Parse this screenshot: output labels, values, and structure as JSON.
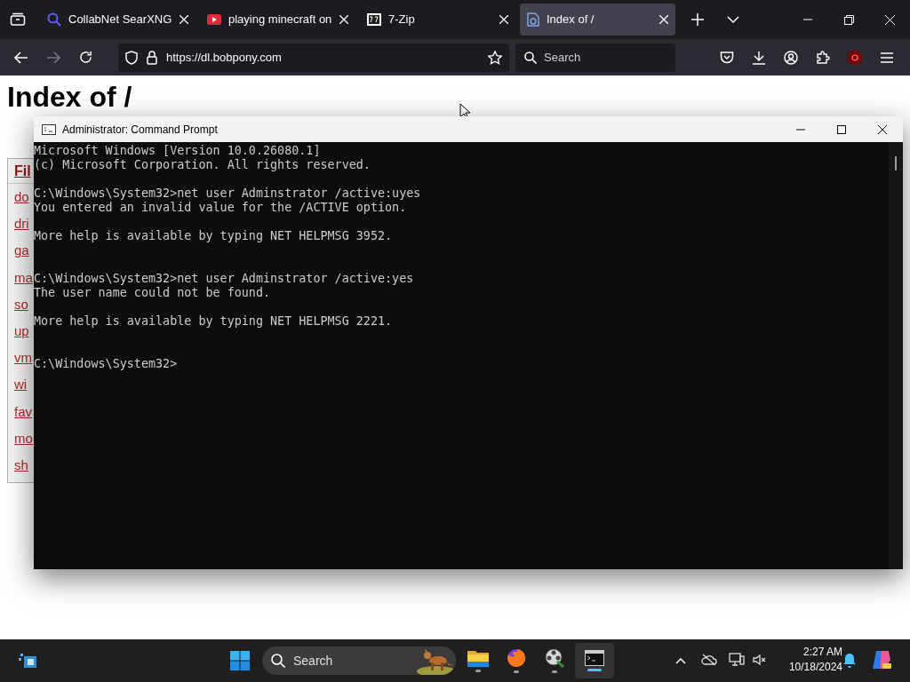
{
  "browser": {
    "tabs": [
      {
        "title": "CollabNet SearXNG",
        "selected": false
      },
      {
        "title": "playing minecraft on",
        "selected": false
      },
      {
        "title": "7-Zip",
        "selected": false
      },
      {
        "title": "Index of /",
        "selected": true
      }
    ],
    "url": "https://dl.bobpony.com",
    "search": {
      "placeholder": "Search"
    }
  },
  "page": {
    "heading": "Index of /",
    "table_header": "Fil",
    "links": [
      "do",
      "dri",
      "ga",
      "ma",
      "so",
      "up",
      "vm",
      "wi",
      "fav",
      "mo",
      "sh"
    ]
  },
  "console_window": {
    "title": "Administrator: Command Prompt",
    "lines": [
      {
        "kind": "text",
        "text": "Microsoft Windows [Version 10.0.26080.1]"
      },
      {
        "kind": "text",
        "text": "(c) Microsoft Corporation. All rights reserved."
      },
      {
        "kind": "blank"
      },
      {
        "kind": "text",
        "text": "C:\\Windows\\System32>net user Adminstrator /active:uyes"
      },
      {
        "kind": "text",
        "text": "You entered an invalid value for the /ACTIVE option."
      },
      {
        "kind": "blank"
      },
      {
        "kind": "text",
        "text": "More help is available by typing NET HELPMSG 3952."
      },
      {
        "kind": "blank"
      },
      {
        "kind": "blank"
      },
      {
        "kind": "text",
        "text": "C:\\Windows\\System32>net user Adminstrator /active:yes"
      },
      {
        "kind": "text",
        "text": "The user name could not be found."
      },
      {
        "kind": "blank"
      },
      {
        "kind": "text",
        "text": "More help is available by typing NET HELPMSG 2221."
      },
      {
        "kind": "blank"
      },
      {
        "kind": "blank"
      },
      {
        "kind": "text",
        "text": "C:\\Windows\\System32>"
      }
    ]
  },
  "taskbar": {
    "search": {
      "placeholder": "Search"
    },
    "time": "2:27 AM",
    "date": "10/18/2024"
  }
}
